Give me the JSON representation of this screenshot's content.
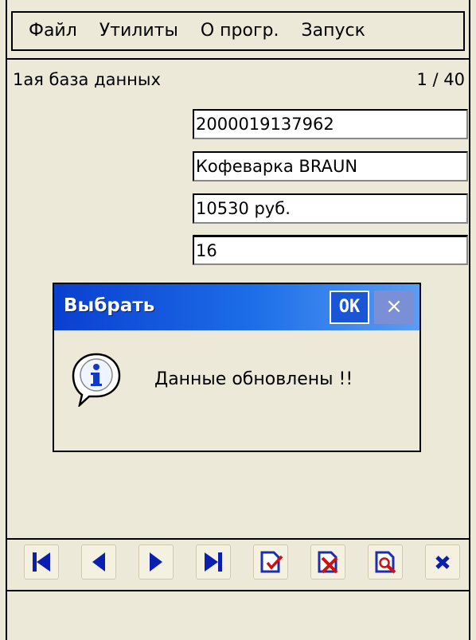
{
  "menu": {
    "items": [
      "Файл",
      "Утилиты",
      "О прогр.",
      "Запуск"
    ]
  },
  "status": {
    "db_name": "1ая база данных",
    "counter": "1 / 40"
  },
  "fields": {
    "barcode": "2000019137962",
    "name": "Кофеварка BRAUN",
    "price": "10530 руб.",
    "quantity": "16"
  },
  "dialog": {
    "title": "Выбрать",
    "ok_label": "OK",
    "close_label": "×",
    "message": "Данные обновлены !!",
    "icon": "info-icon"
  },
  "toolbar": {
    "buttons": [
      {
        "name": "first-record-button",
        "icon": "skip-first-icon"
      },
      {
        "name": "prev-record-button",
        "icon": "triangle-left-icon"
      },
      {
        "name": "next-record-button",
        "icon": "triangle-right-icon"
      },
      {
        "name": "last-record-button",
        "icon": "skip-last-icon"
      },
      {
        "name": "edit-record-button",
        "icon": "document-check-icon"
      },
      {
        "name": "delete-record-button",
        "icon": "document-x-icon"
      },
      {
        "name": "search-record-button",
        "icon": "document-search-icon"
      },
      {
        "name": "close-button",
        "icon": "close-x-icon"
      }
    ]
  },
  "colors": {
    "background": "#ece9d8",
    "title_bar": "#1d6ee8",
    "nav_blue": "#0a1fb0",
    "delete_red": "#d01010"
  }
}
